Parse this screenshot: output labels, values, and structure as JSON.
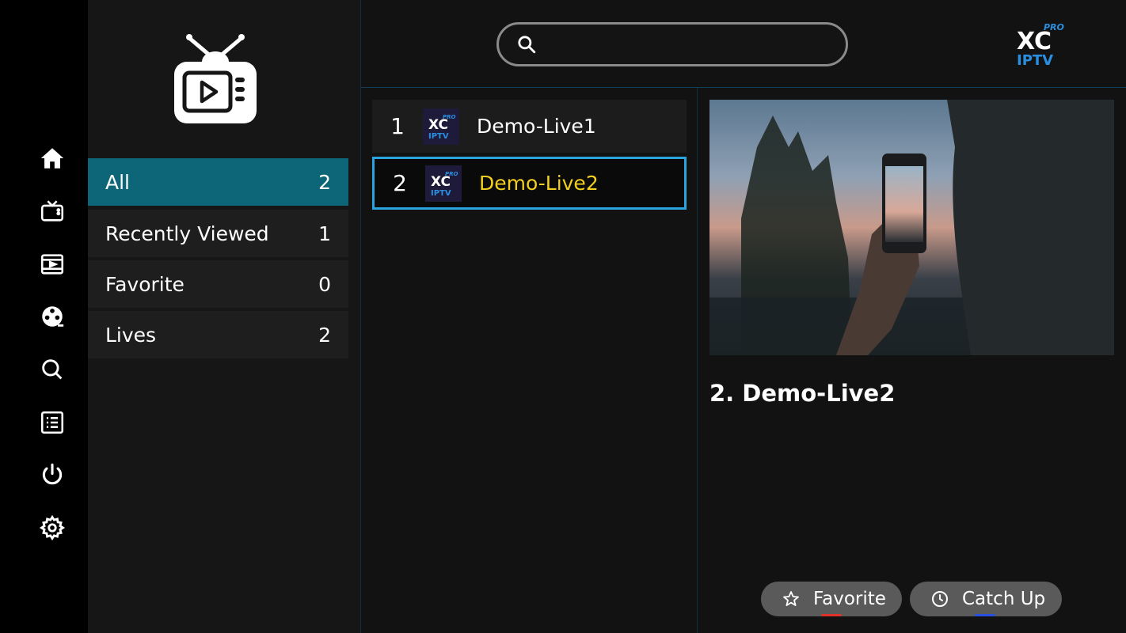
{
  "search": {
    "placeholder": ""
  },
  "categories": [
    {
      "label": "All",
      "count": "2"
    },
    {
      "label": "Recently Viewed",
      "count": "1"
    },
    {
      "label": "Favorite",
      "count": "0"
    },
    {
      "label": "Lives",
      "count": "2"
    }
  ],
  "channels": [
    {
      "number": "1",
      "name": "Demo-Live1"
    },
    {
      "number": "2",
      "name": "Demo-Live2"
    }
  ],
  "preview": {
    "title": "2.  Demo-Live2"
  },
  "buttons": {
    "favorite": "Favorite",
    "catchup": "Catch Up"
  },
  "colors": {
    "active_category": "#0c6678",
    "selected_border": "#2aa4dc",
    "selected_text": "#f2d01f",
    "brand_blue": "#2a8fe0",
    "favorite_key": "#e0302a",
    "catchup_key": "#2a4fe0"
  },
  "icons": [
    "home-icon",
    "live-tv-icon",
    "movies-icon",
    "series-icon",
    "search-icon",
    "epg-list-icon",
    "power-icon",
    "settings-icon"
  ]
}
